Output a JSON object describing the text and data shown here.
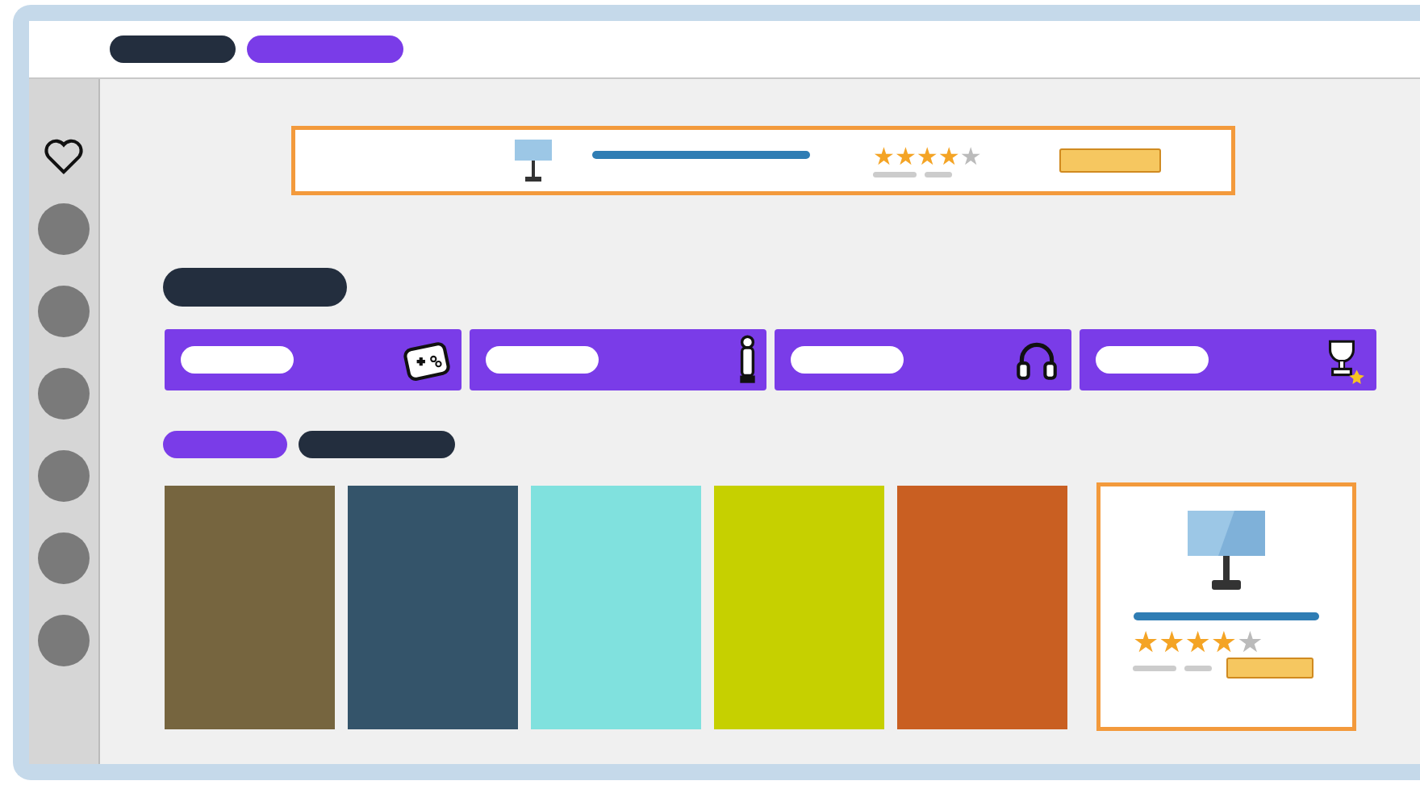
{
  "top_nav": {
    "tabs": [
      {
        "selected": false
      },
      {
        "selected": true
      }
    ]
  },
  "featured": {
    "stars": 4
  },
  "categories": {
    "banners": [
      {
        "kind": "gamepad"
      },
      {
        "kind": "figure"
      },
      {
        "kind": "headphones"
      },
      {
        "kind": "trophy"
      }
    ]
  },
  "products": {
    "tabs": [
      {
        "selected": true
      },
      {
        "selected": false
      }
    ],
    "tiles": [
      {
        "color": "#76653f"
      },
      {
        "color": "#34546a"
      },
      {
        "color": "#80e1de"
      },
      {
        "color": "#c6d000"
      },
      {
        "color": "#c95f22"
      }
    ],
    "card": {
      "stars": 4
    }
  }
}
